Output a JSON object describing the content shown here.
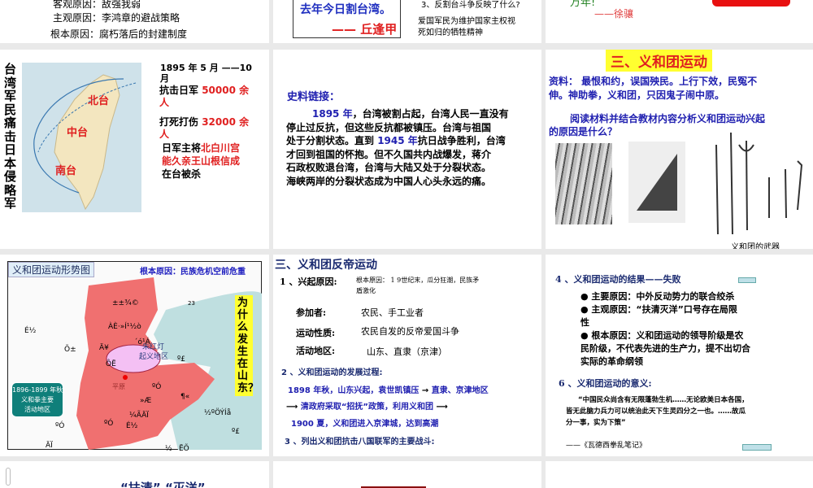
{
  "slides": {
    "s1": {
      "lines": [
        "客观原因：敌强我弱",
        "主观原因：李鸿章的避战策略",
        "根本原因：腐朽落后的封建制度"
      ]
    },
    "s2": {
      "poem": "去年今日割台湾。",
      "author": "—— 丘逢甲",
      "question": "3、反割台斗争反映了什么?",
      "answer1": "爱国军民为维护国家主权视",
      "answer2": "死如归的牺牲精神"
    },
    "s3": {
      "partial": "万年!",
      "author": "——徐骧"
    },
    "s4": {
      "vertical_title": "台湾军民痛击日本侵略军",
      "map_labels": [
        "北台",
        "中台",
        "南台"
      ],
      "date1": "1895 年 5 月 ——10",
      "date2": "月",
      "l1a": "抗击日军 ",
      "l1b": "50000 余",
      "l1c": "人",
      "l2a": "打死打伤 ",
      "l2b": "32000 余",
      "l2c": "人",
      "l3a": "日军主将",
      "l3b": "北白川宫",
      "l3c": "能久亲王山根信成",
      "l3d": "在台被杀"
    },
    "s5": {
      "heading": "史料链接：",
      "y1": "1895 年",
      "t1": "，台湾被割占起，台湾人民一直没有",
      "t2": "停止过反抗，但这些反抗都被镇压。台湾与祖国",
      "t3a": "处于分割状态。直到 ",
      "y2": "1945 年",
      "t3b": "抗日战争胜利，台湾",
      "t4": "才回到祖国的怀抱。但不久国共内战爆发，蒋介",
      "t5": "石政权败退台湾，台湾与大陆又处于分裂状态。",
      "t6": "海峡两岸的分裂状态成为中国人心头永远的痛。"
    },
    "s6": {
      "title": "三、义和团运动",
      "m1": "资料：  最恨和约，误国殃民。上行下效，民冤不",
      "m2": "伸。神助拳，义和团，只因鬼子闹中原。",
      "q1": "阅读材料并结合教材内容分析义和团运动兴起",
      "q2": "的原因是什么？",
      "caption": "义和团的武器"
    },
    "s7": {
      "title": "义和团运动形势图",
      "root": "根本原因：民族危机空前危重",
      "why": "为什么发生在山东？",
      "bubble1": "朱红灯",
      "bubble2": "起义地区",
      "city": "平原",
      "callout": [
        "1896-1899 年秋",
        "义和拳主要",
        "活动地区"
      ],
      "garbled": [
        "±±¾©",
        "ÀÈ·»Í¹½ò",
        "´ó¹Á",
        "Ä¥",
        "ÔË",
        "ºÓ",
        "»Æ",
        "¶«",
        "¼ÃÄÏ",
        "ºÓ",
        "É½",
        "½ºÖÝÍå",
        "º£",
        "º£",
        "É½",
        "Õ±",
        "ºÓ",
        "ÄÏ",
        "½",
        "ËÕ",
        "23"
      ]
    },
    "s8": {
      "title": "三、义和团反帝运动",
      "h1": "1 、兴起原因:",
      "h1t1": "根本原因： 1 9世纪末，瓜分狂潮，民族矛",
      "h1t2": "盾激化",
      "k1": "参加者:",
      "v1": "农民、手工业者",
      "k2": "运动性质:",
      "v2": "农民自发的反帝爱国斗争",
      "k3": "活动地区:",
      "v3": "山东、直隶（京津）",
      "h2": "2 、义和团运动的发展过程:",
      "p1a": "1898 年秋，山东兴起，袁世凯镇压",
      "p1b": "直隶、京津地区",
      "p2": "清政府采取“招抚”政策，利用义和团",
      "p3": "1900 夏，义和团进入京津城，达到高潮",
      "h3": "3 、列出义和团抗击八国联军的主要战斗:"
    },
    "s9": {
      "h4": "4 、义和团运动的结果——失败",
      "b1": "● 主要原因：中外反动势力的联合绞杀",
      "b2": "● 主观原因：“扶清灭洋”口号存在局限",
      "b2c": "性",
      "b3": "● 根本原因：义和团运动的领导阶级是农",
      "b3c": "民阶级，不代表先进的生产力，提不出切合",
      "b3d": "实际的革命纲领",
      "h6": "6 、义和团运动的意义:",
      "q1": "“中国民众尚含有无限蓬勃生机……无论欧美日本各国，",
      "q2": "皆无此脑力兵力可以统治此天下生灵四分之一也。……故瓜",
      "q3": "分一事，实为下策”",
      "src": "——《瓦德西拳乱笔记》"
    },
    "s10": {
      "partial": "“扶清”    “灭洋”"
    }
  },
  "colors": {
    "red": "#e02020",
    "blue": "#2020b0",
    "map_red": "#f07070",
    "sea": "#bfdfe0",
    "yellow": "#ffff30"
  }
}
